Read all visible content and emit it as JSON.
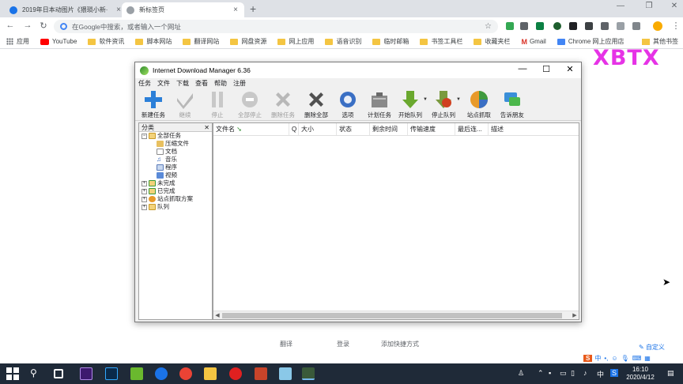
{
  "browser": {
    "tabs": [
      {
        "title": "2019年日本动图片《猥琐小新·",
        "active": false
      },
      {
        "title": "新标签页",
        "active": true
      }
    ],
    "omnibox_placeholder": "在Google中搜索，或者输入一个网址",
    "bookmarks": [
      "应用",
      "YouTube",
      "软件资讯",
      "脚本网站",
      "翻译网站",
      "网盘资源",
      "网上应用",
      "语音识别",
      "临时邮箱",
      "书签工具栏",
      "收藏夹栏",
      "Gmail",
      "Chrome 网上应用店"
    ],
    "other_bookmarks": "其他书签"
  },
  "page": {
    "watermark": "XBTX",
    "shortcuts": [
      "翻译",
      "登录",
      "添加快捷方式"
    ],
    "customize": "自定义"
  },
  "idm": {
    "title": "Internet Download Manager 6.36",
    "menu": [
      "任务",
      "文件",
      "下载",
      "查看",
      "帮助",
      "注册"
    ],
    "toolbar": [
      {
        "label": "新建任务",
        "icon": "plus-icon",
        "enabled": true
      },
      {
        "label": "继续",
        "icon": "check-icon",
        "enabled": false
      },
      {
        "label": "停止",
        "icon": "pause-icon",
        "enabled": false
      },
      {
        "label": "全部停止",
        "icon": "stop-icon",
        "enabled": false
      },
      {
        "label": "删除任务",
        "icon": "delete-icon",
        "enabled": false
      },
      {
        "label": "删除全部",
        "icon": "delete-all-icon",
        "enabled": true
      },
      {
        "label": "选项",
        "icon": "gear-icon",
        "enabled": true
      },
      {
        "label": "计划任务",
        "icon": "scheduler-icon",
        "enabled": true
      },
      {
        "label": "开始队列",
        "icon": "start-queue-icon",
        "enabled": true
      },
      {
        "label": "停止队列",
        "icon": "stop-queue-icon",
        "enabled": true
      },
      {
        "label": "站点抓取",
        "icon": "grabber-icon",
        "enabled": true
      },
      {
        "label": "告诉朋友",
        "icon": "tell-friend-icon",
        "enabled": true
      }
    ],
    "categories_header": "分类",
    "tree": [
      {
        "label": "全部任务",
        "level": 0,
        "expander": "−"
      },
      {
        "label": "压缩文件",
        "level": 1,
        "expander": ""
      },
      {
        "label": "文档",
        "level": 1,
        "expander": ""
      },
      {
        "label": "音乐",
        "level": 1,
        "expander": ""
      },
      {
        "label": "程序",
        "level": 1,
        "expander": ""
      },
      {
        "label": "视频",
        "level": 1,
        "expander": ""
      },
      {
        "label": "未完成",
        "level": 0,
        "expander": "+"
      },
      {
        "label": "已完成",
        "level": 0,
        "expander": "+"
      },
      {
        "label": "站点抓取方案",
        "level": 0,
        "expander": "+"
      },
      {
        "label": "队列",
        "level": 0,
        "expander": "+"
      }
    ],
    "columns": [
      "文件名",
      "Q",
      "大小",
      "状态",
      "剩余时间",
      "传输速度",
      "最后连...",
      "描述"
    ]
  },
  "taskbar": {
    "time": "16:10",
    "date": "2020/4/12",
    "ime": "中"
  }
}
